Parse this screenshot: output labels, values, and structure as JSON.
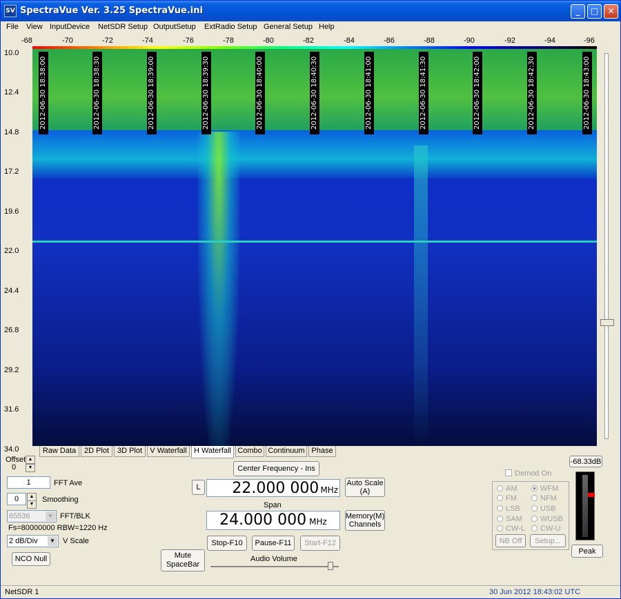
{
  "window": {
    "title": "SpectraVue Ver. 3.25  SpectraVue.ini",
    "icon": "SV",
    "min_label": "_",
    "max_label": "□",
    "close_label": "✕"
  },
  "menu": [
    "File",
    "View",
    "InputDevice",
    "NetSDR Setup",
    "OutputSetup",
    "ExtRadio Setup",
    "General Setup",
    "Help"
  ],
  "db_scale": [
    "-68",
    "-70",
    "-72",
    "-74",
    "-76",
    "-78",
    "-80",
    "-82",
    "-84",
    "-86",
    "-88",
    "-90",
    "-92",
    "-94",
    "-96"
  ],
  "freq_scale": [
    "10.0",
    "12.4",
    "14.8",
    "17.2",
    "19.6",
    "22.0",
    "24.4",
    "26.8",
    "29.2",
    "31.6",
    "34.0"
  ],
  "timestamps": [
    "2012-06-30 18:38:00",
    "2012-06-30 18:38:30",
    "2012-06-30 18:39:00",
    "2012-06-30 18:39:30",
    "2012-06-30 18:40:00",
    "2012-06-30 18:40:30",
    "2012-06-30 18:41:00",
    "2012-06-30 18:41:30",
    "2012-06-30 18:42:00",
    "2012-06-30 18:42:30",
    "2012-06-30 18:43:00"
  ],
  "tabs": [
    "Raw Data",
    "2D Plot",
    "3D Plot",
    "V Waterfall",
    "H Waterfall",
    "Combo",
    "Continuum",
    "Phase"
  ],
  "active_tab": "H Waterfall",
  "controls": {
    "offset_label": "Offset",
    "offset_value": "0",
    "fft_ave_value": "1",
    "fft_ave_label": "FFT Ave",
    "smoothing_value": "0",
    "smoothing_label": "Smoothing",
    "fft_blk_value": "65536",
    "fft_blk_label": "FFT/BLK",
    "fs_text": "Fs=80000000 RBW=1220 Hz",
    "vscale_value": "2 dB/Div",
    "vscale_label": "V Scale",
    "nco_null": "NCO Null",
    "mute": "Mute SpaceBar",
    "center_freq_btn": "Center Frequency - Ins",
    "l_btn": "L",
    "center_freq_value": "22.000 000",
    "center_freq_unit": "MHz",
    "auto_scale": "Auto Scale (A)",
    "span_label": "Span",
    "span_value": "24.000 000",
    "span_unit": "MHz",
    "memory": "Memory(M) Channels",
    "stop": "Stop-F10",
    "pause": "Pause-F11",
    "start": "Start-F12",
    "audio_label": "Audio Volume",
    "demod_on": "Demod On",
    "modes_left": [
      "AM",
      "FM",
      "LSB",
      "SAM",
      "CW-L"
    ],
    "modes_right": [
      "WFM",
      "NFM",
      "USB",
      "WUSB",
      "CW-U"
    ],
    "nb_off": "NB Off",
    "setup": "Setup...",
    "level": "-68.33dB",
    "peak": "Peak"
  },
  "status": {
    "left": "NetSDR 1",
    "right": "30 Jun 2012  18:43:02 UTC"
  }
}
